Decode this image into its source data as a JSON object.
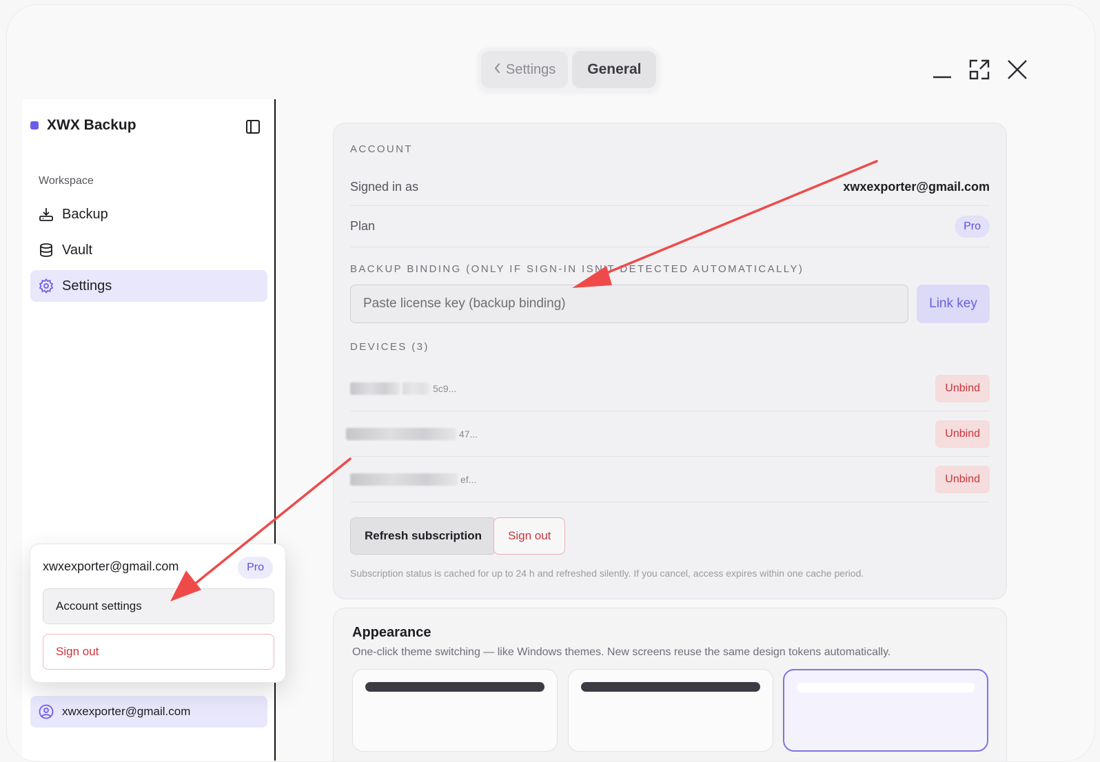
{
  "topbar": {
    "back_label": "Settings",
    "current_label": "General"
  },
  "sidebar": {
    "brand": "XWX Backup",
    "section_label": "Workspace",
    "items": [
      {
        "label": "Backup",
        "icon": "download-tray-icon"
      },
      {
        "label": "Vault",
        "icon": "database-icon"
      },
      {
        "label": "Settings",
        "icon": "gear-icon",
        "active": true
      }
    ],
    "user_email": "xwxexporter@gmail.com"
  },
  "popover": {
    "email": "xwxexporter@gmail.com",
    "badge": "Pro",
    "account_settings": "Account settings",
    "sign_out": "Sign out"
  },
  "account": {
    "section_title": "ACCOUNT",
    "signed_in_label": "Signed in as",
    "signed_in_value": "xwxexporter@gmail.com",
    "plan_label": "Plan",
    "plan_value": "Pro",
    "binding_title": "BACKUP BINDING (ONLY IF SIGN-IN ISN'T DETECTED AUTOMATICALLY)",
    "key_placeholder": "Paste license key (backup binding)",
    "link_key": "Link key",
    "devices_title": "DEVICES (3)",
    "devices": [
      {
        "id_suffix": "5c9...",
        "action": "Unbind"
      },
      {
        "id_suffix": "47...",
        "action": "Unbind"
      },
      {
        "id_suffix": "ef...",
        "action": "Unbind"
      }
    ],
    "refresh": "Refresh subscription",
    "sign_out": "Sign out",
    "note": "Subscription status is cached for up to 24 h and refreshed silently. If you cancel, access expires within one cache period."
  },
  "appearance": {
    "title": "Appearance",
    "subtitle": "One-click theme switching — like Windows themes. New screens reuse the same design tokens automatically."
  },
  "colors": {
    "accent": "#6d5ce8",
    "danger": "#d0343b",
    "annotation_arrow": "#ef4a4a"
  }
}
